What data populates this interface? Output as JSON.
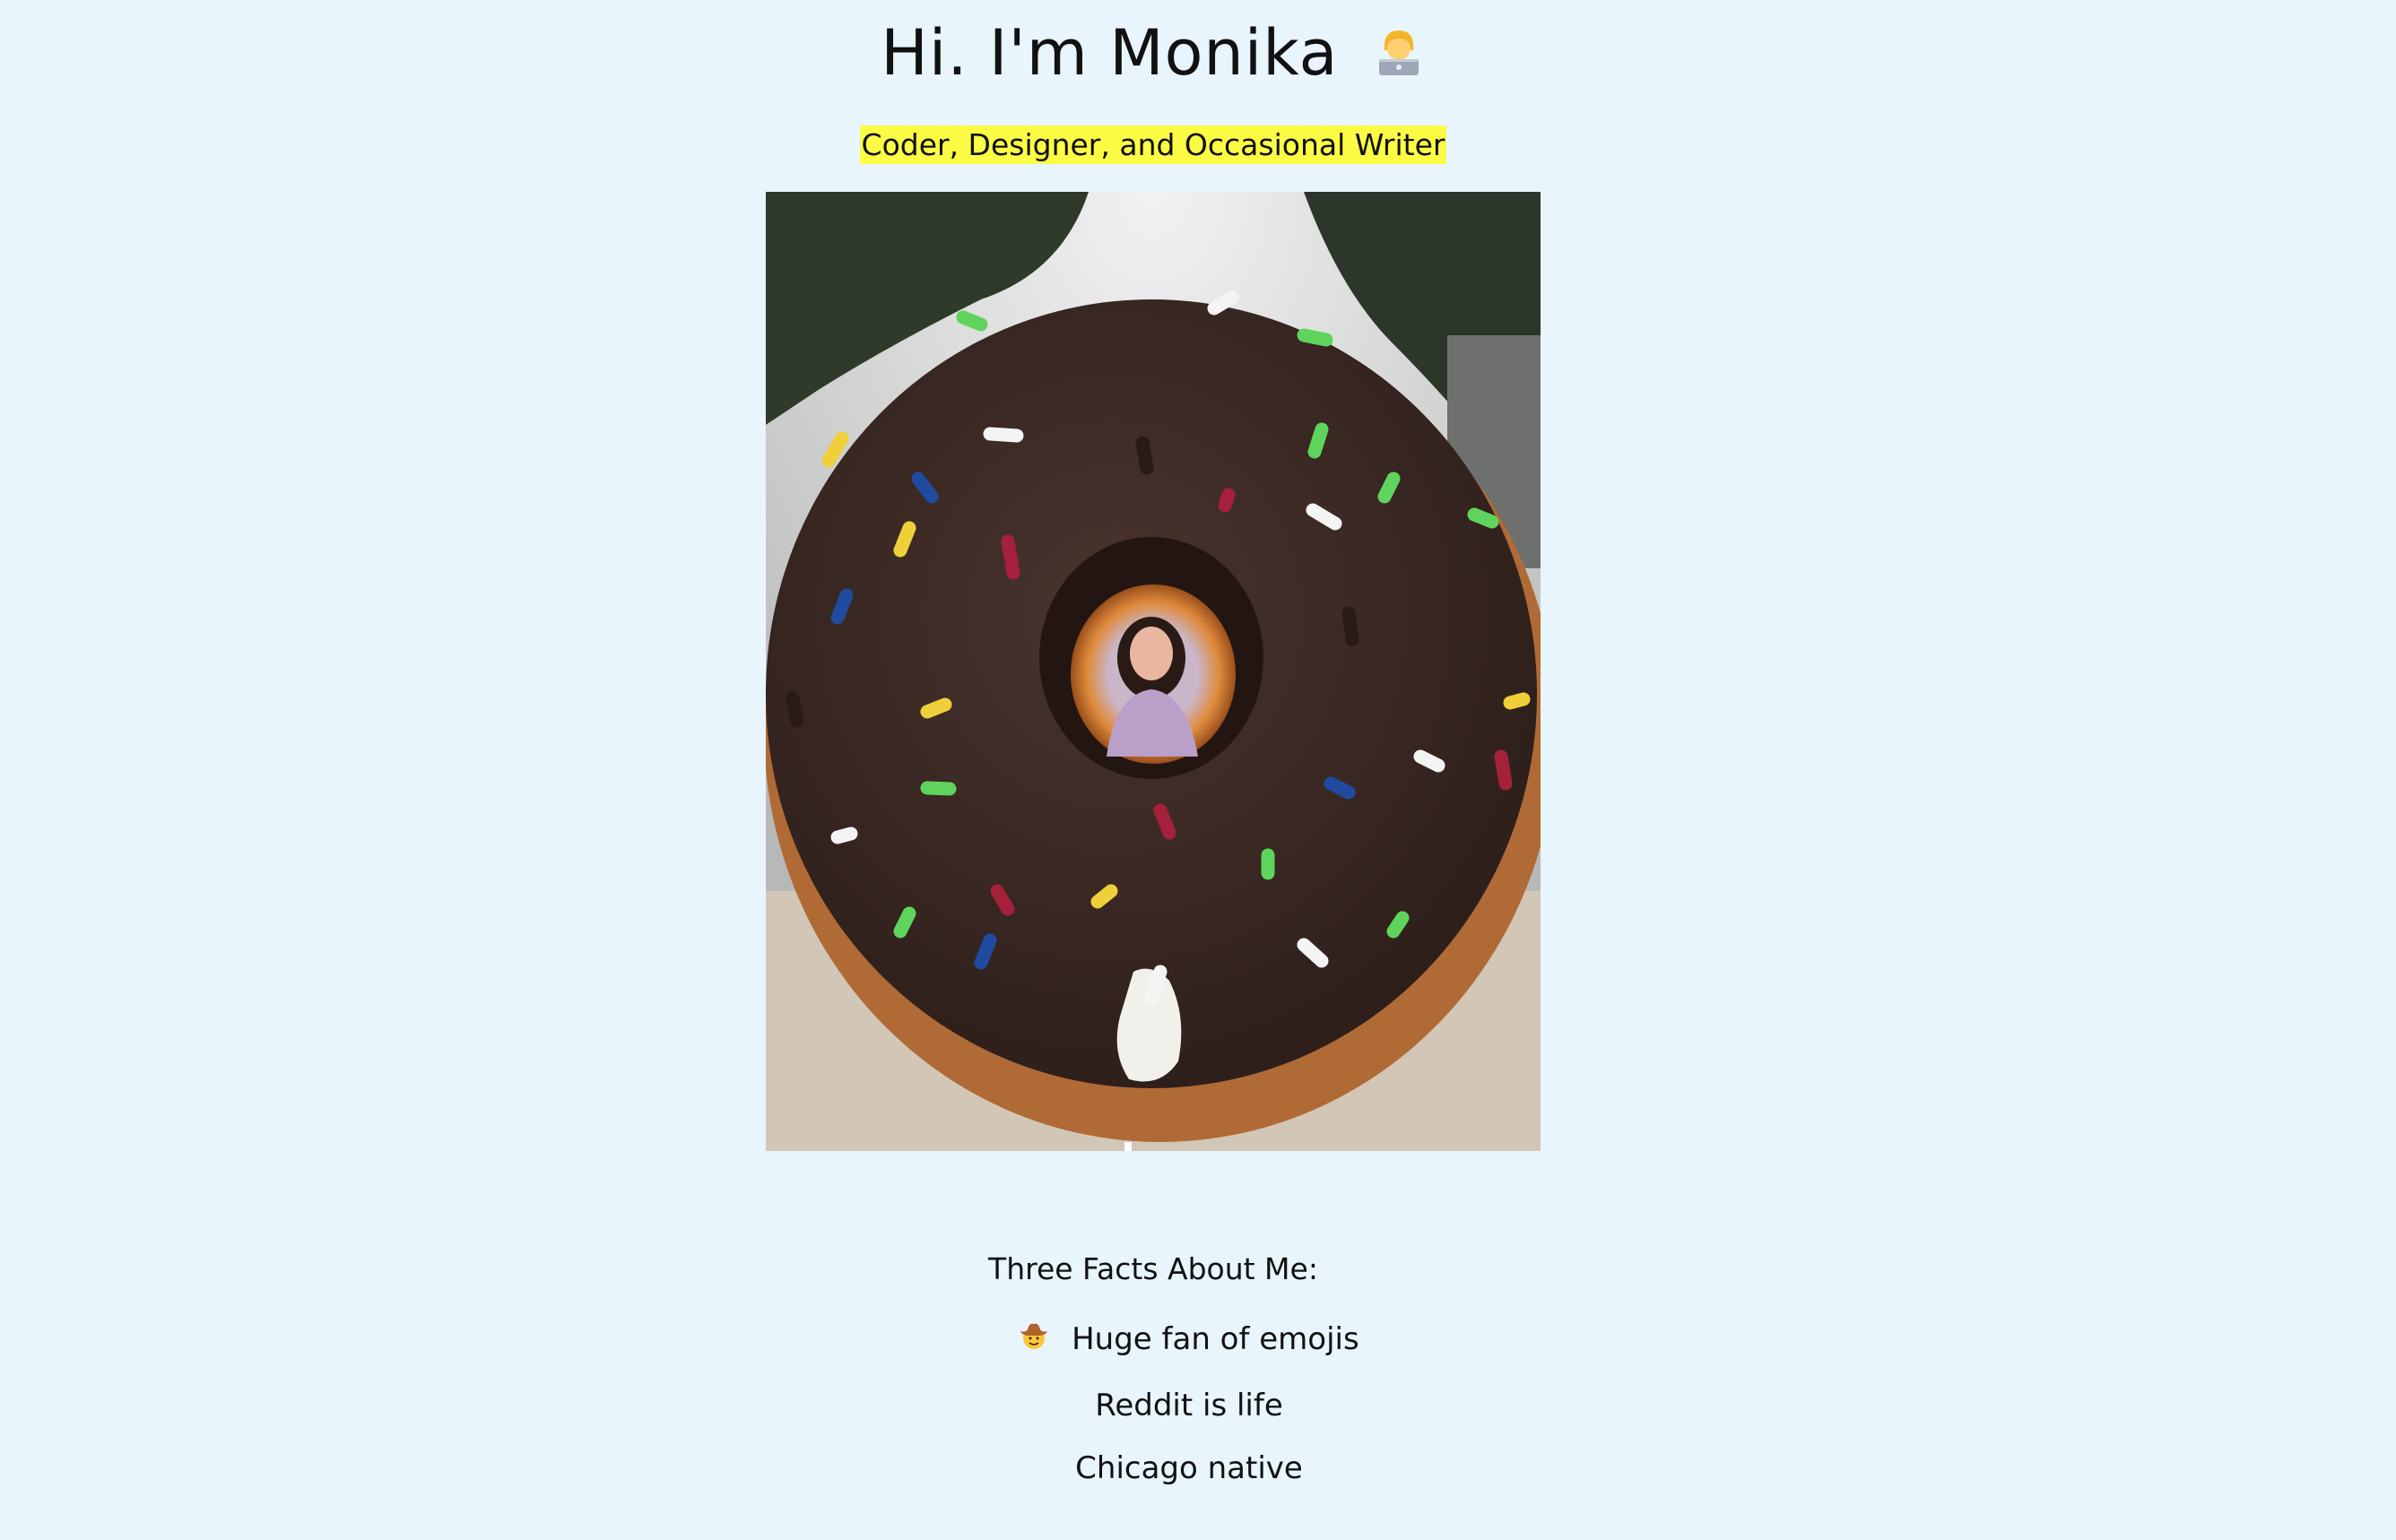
{
  "header": {
    "title": "Hi. I'm Monika",
    "title_icon": "woman-technologist-emoji",
    "subtitle": "Coder, Designer, and Occasional Writer",
    "subtitle_highlight": "#fcfc45"
  },
  "photo": {
    "icon": "giant-donut-photo"
  },
  "facts": {
    "heading": "Three Facts About Me:",
    "items": [
      {
        "text": "Huge fan of emojis",
        "icon": "cowboy-hat-face-emoji"
      },
      {
        "text": "Reddit is life"
      },
      {
        "text": "Chicago native"
      }
    ]
  },
  "colors": {
    "background": "#e8f5fd",
    "donut_frosting": "#3b2823"
  }
}
